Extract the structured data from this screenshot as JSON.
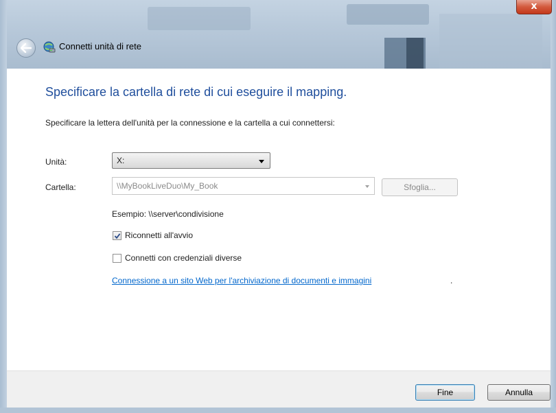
{
  "window": {
    "title": "Connetti unità di rete",
    "close_glyph": "x"
  },
  "main": {
    "heading": "Specificare la cartella di rete di cui eseguire il mapping.",
    "instruction": "Specificare la lettera dell'unità per la connessione e la cartella a cui connettersi:",
    "drive_label": "Unità:",
    "drive_value": "X:",
    "folder_label": "Cartella:",
    "folder_value": "\\\\MyBookLiveDuo\\My_Book",
    "browse_label": "Sfoglia...",
    "example_text": "Esempio: \\\\server\\condivisione",
    "reconnect_label": "Riconnetti all'avvio",
    "reconnect_checked": true,
    "credentials_label": "Connetti con credenziali diverse",
    "credentials_checked": false,
    "link_text": "Connessione a un sito Web per l'archiviazione di documenti e immagini",
    "link_suffix": "."
  },
  "footer": {
    "finish_label": "Fine",
    "cancel_label": "Annulla"
  },
  "colors": {
    "heading": "#1f4e9c",
    "link": "#0066cc",
    "close_button": "#c3381a"
  },
  "icons": {
    "back": "back-arrow-icon",
    "title": "network-drive-icon",
    "close": "close-icon",
    "dropdown": "chevron-down-icon",
    "check": "checkmark-icon"
  }
}
